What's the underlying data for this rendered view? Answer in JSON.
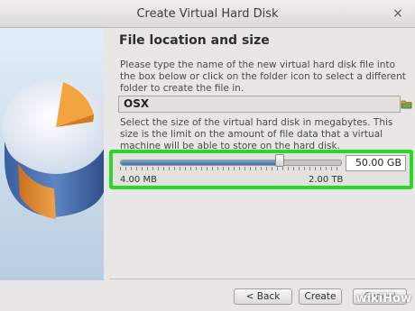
{
  "window": {
    "title": "Create Virtual Hard Disk",
    "close_glyph": "×"
  },
  "page": {
    "heading": "File location and size",
    "location_description": "Please type the name of the new virtual hard disk file into the box below or click on the folder icon to select a different folder to create the file in.",
    "file_name": "OSX",
    "folder_icon": "folder-icon",
    "size_description": "Select the size of the virtual hard disk in megabytes. This size is the limit on the amount of file data that a virtual machine will be able to store on the hard disk.",
    "size_value": "50.00 GB",
    "slider_fraction": 0.72,
    "min_label": "4.00 MB",
    "max_label": "2.00 TB",
    "highlight_color": "#29d729"
  },
  "buttons": {
    "back": "< Back",
    "create": "Create",
    "cancel": "Cancel"
  },
  "watermark": {
    "prefix": "wiki",
    "suffix": "How"
  }
}
